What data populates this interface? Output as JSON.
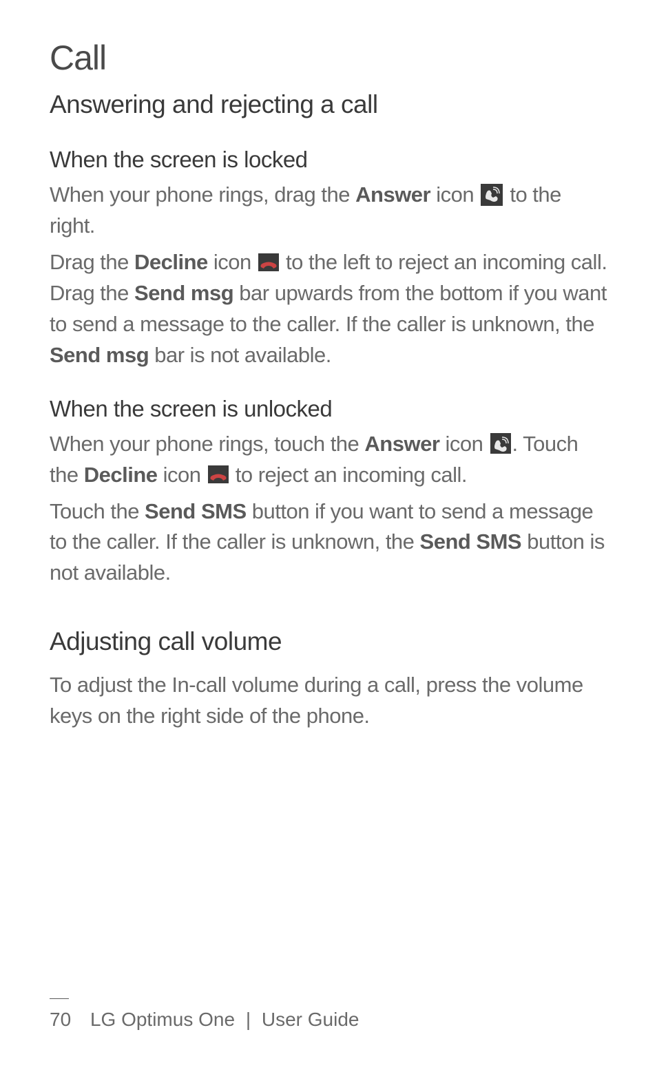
{
  "page_heading": "Call",
  "section1": {
    "heading": "Answering and rejecting a call",
    "sub1_heading": "When the screen is locked",
    "sub1_p1_a": "When your phone rings, drag the ",
    "sub1_p1_b": "Answer",
    "sub1_p1_c": " icon ",
    "sub1_p1_d": " to the right.",
    "sub1_p2_a": "Drag the ",
    "sub1_p2_b": "Decline",
    "sub1_p2_c": " icon ",
    "sub1_p2_d": " to the left to reject an incoming call. Drag the ",
    "sub1_p2_e": "Send msg",
    "sub1_p2_f": " bar upwards from the bottom if you want to send a message to the caller. If the caller is unknown, the ",
    "sub1_p2_g": "Send msg",
    "sub1_p2_h": " bar is not available.",
    "sub2_heading": "When the screen is unlocked",
    "sub2_p1_a": "When your phone rings, touch the ",
    "sub2_p1_b": "Answer",
    "sub2_p1_c": " icon ",
    "sub2_p1_d": ". Touch the ",
    "sub2_p1_e": "Decline",
    "sub2_p1_f": " icon ",
    "sub2_p1_g": " to reject an incoming call.",
    "sub2_p2_a": "Touch the ",
    "sub2_p2_b": "Send SMS",
    "sub2_p2_c": " button if you want to send a message to the caller. If the caller is unknown, the ",
    "sub2_p2_d": "Send SMS",
    "sub2_p2_e": " button is not available."
  },
  "section2": {
    "heading": "Adjusting call volume",
    "p1": "To adjust the In-call volume during a call, press the volume keys on the right side of the phone."
  },
  "footer": {
    "page_num": "70",
    "product": "LG Optimus One",
    "separator": "|",
    "doc_title": "User Guide"
  }
}
